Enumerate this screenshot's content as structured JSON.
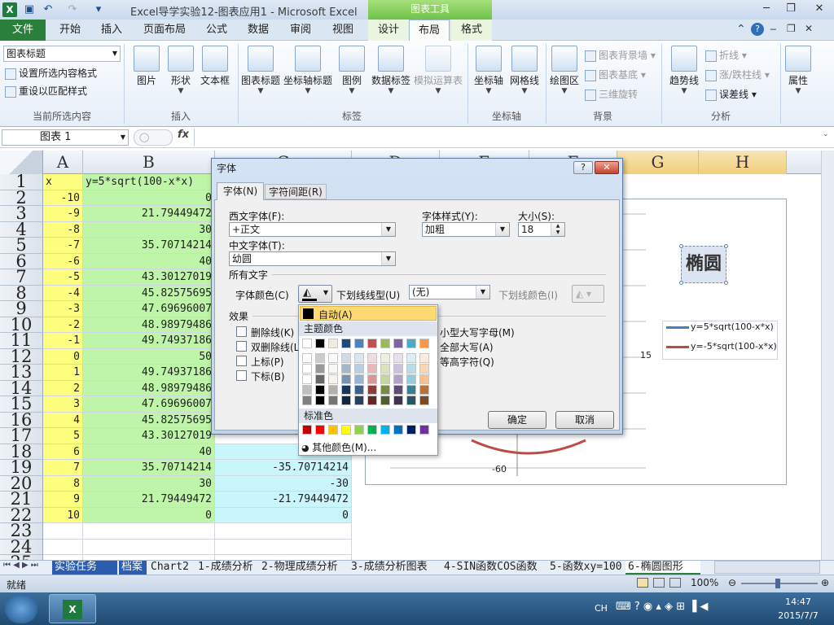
{
  "window": {
    "app_icon": "X",
    "title": "Excel导学实验12-图表应用1  -  Microsoft Excel",
    "context_title": "图表工具"
  },
  "tabs": [
    {
      "label": "文件"
    },
    {
      "label": "开始"
    },
    {
      "label": "插入"
    },
    {
      "label": "页面布局"
    },
    {
      "label": "公式"
    },
    {
      "label": "数据"
    },
    {
      "label": "审阅"
    },
    {
      "label": "视图"
    },
    {
      "label": "设计"
    },
    {
      "label": "布局"
    },
    {
      "label": "格式"
    }
  ],
  "ribbon": {
    "current_selection": {
      "combo_value": "图表标题",
      "format_selection": "设置所选内容格式",
      "reset_style": "重设以匹配样式",
      "group": "当前所选内容"
    },
    "insert": {
      "picture": "图片",
      "shapes": "形状",
      "textbox": "文本框",
      "group": "插入"
    },
    "labels": {
      "chart_title": "图表标题",
      "axis_title": "坐标轴标题",
      "legend": "图例",
      "data_labels": "数据标签",
      "data_table": "模拟运算表",
      "group": "标签"
    },
    "axes": {
      "axes": "坐标轴",
      "gridlines": "网格线",
      "group": "坐标轴"
    },
    "background": {
      "plot_area": "绘图区",
      "chart_wall": "图表背景墙",
      "chart_floor": "图表基底",
      "rotation": "三维旋转",
      "group": "背景"
    },
    "analysis": {
      "trendline": "趋势线",
      "lines": "折线",
      "updown": "涨/跌柱线",
      "error": "误差线",
      "group": "分析"
    },
    "properties": {
      "label": "属性"
    }
  },
  "formula_bar": {
    "name_box": "图表 1",
    "fx": "fx",
    "formula": ""
  },
  "sheet": {
    "columns": [
      "A",
      "B",
      "C",
      "D",
      "E",
      "F",
      "G",
      "H"
    ],
    "rows": [
      {
        "n": "1",
        "a": "x",
        "b": "y=5*sqrt(100-x*x)",
        "c": ""
      },
      {
        "n": "2",
        "a": "-10",
        "b": "0",
        "c": ""
      },
      {
        "n": "3",
        "a": "-9",
        "b": "21.79449472",
        "c": ""
      },
      {
        "n": "4",
        "a": "-8",
        "b": "30",
        "c": ""
      },
      {
        "n": "5",
        "a": "-7",
        "b": "35.70714214",
        "c": ""
      },
      {
        "n": "6",
        "a": "-6",
        "b": "40",
        "c": ""
      },
      {
        "n": "7",
        "a": "-5",
        "b": "43.30127019",
        "c": ""
      },
      {
        "n": "8",
        "a": "-4",
        "b": "45.82575695",
        "c": ""
      },
      {
        "n": "9",
        "a": "-3",
        "b": "47.69696007",
        "c": ""
      },
      {
        "n": "10",
        "a": "-2",
        "b": "48.98979486",
        "c": ""
      },
      {
        "n": "11",
        "a": "-1",
        "b": "49.74937186",
        "c": ""
      },
      {
        "n": "12",
        "a": "0",
        "b": "50",
        "c": ""
      },
      {
        "n": "13",
        "a": "1",
        "b": "49.74937186",
        "c": ""
      },
      {
        "n": "14",
        "a": "2",
        "b": "48.98979486",
        "c": ""
      },
      {
        "n": "15",
        "a": "3",
        "b": "47.69696007",
        "c": ""
      },
      {
        "n": "16",
        "a": "4",
        "b": "45.82575695",
        "c": ""
      },
      {
        "n": "17",
        "a": "5",
        "b": "43.30127019",
        "c": ""
      },
      {
        "n": "18",
        "a": "6",
        "b": "40",
        "c": ""
      },
      {
        "n": "19",
        "a": "7",
        "b": "35.70714214",
        "c": "-35.70714214"
      },
      {
        "n": "20",
        "a": "8",
        "b": "30",
        "c": "-30"
      },
      {
        "n": "21",
        "a": "9",
        "b": "21.79449472",
        "c": "-21.79449472"
      },
      {
        "n": "22",
        "a": "10",
        "b": "0",
        "c": "0"
      },
      {
        "n": "23",
        "a": "",
        "b": "",
        "c": ""
      },
      {
        "n": "24",
        "a": "",
        "b": "",
        "c": ""
      },
      {
        "n": "25",
        "a": "",
        "b": "",
        "c": ""
      }
    ]
  },
  "chart": {
    "title": "椭圆",
    "y_tick_15": "15",
    "y_tick_neg60": "-60",
    "legend": [
      "y=5*sqrt(100-x*x)",
      "y=-5*sqrt(100-x*x)"
    ],
    "series_colors": [
      "#4a7ebb",
      "#be4b48"
    ]
  },
  "dialog": {
    "title": "字体",
    "help": "?",
    "close": "✕",
    "tab_font": "字体(N)",
    "tab_spacing": "字符间距(R)",
    "latin_font_label": "西文字体(F):",
    "latin_font_value": "+正文",
    "style_label": "字体样式(Y):",
    "style_value": "加粗",
    "size_label": "大小(S):",
    "size_value": "18",
    "asian_font_label": "中文字体(T):",
    "asian_font_value": "幼圆",
    "all_text_label": "所有文字",
    "font_color_label": "字体颜色(C)",
    "underline_type_label": "下划线线型(U)",
    "underline_type_value": "(无)",
    "underline_color_label": "下划线颜色(I)",
    "effects_label": "效果",
    "strikethrough": "删除线(K)",
    "double_strike": "双删除线(L)",
    "superscript": "上标(P)",
    "subscript": "下标(B)",
    "small_caps": "小型大写字母(M)",
    "all_caps": "全部大写(A)",
    "equalize": "等高字符(Q)",
    "ok": "确定",
    "cancel": "取消"
  },
  "palette": {
    "auto": "自动(A)",
    "theme_label": "主题颜色",
    "standard_label": "标准色",
    "more_colors": "其他颜色(M)...",
    "theme_top": [
      "#ffffff",
      "#000000",
      "#eeece1",
      "#1f497d",
      "#4f81bd",
      "#c0504d",
      "#9bbb59",
      "#8064a2",
      "#4bacc6",
      "#f79646"
    ],
    "standard": [
      "#c00000",
      "#ff0000",
      "#ffc000",
      "#ffff00",
      "#92d050",
      "#00b050",
      "#00b0f0",
      "#0070c0",
      "#002060",
      "#7030a0"
    ]
  },
  "sheet_tabs": [
    "实验任务",
    "档案",
    "Chart2",
    "1-成绩分析",
    "2-物理成绩分析",
    "3-成绩分析图表",
    "4-SIN函数COS函数",
    "5-函数xy=100",
    "6-椭圆图形"
  ],
  "status": {
    "ready": "就绪",
    "zoom": "100%"
  },
  "taskbar": {
    "lang": "CH",
    "time": "14:47",
    "date": "2015/7/7"
  }
}
